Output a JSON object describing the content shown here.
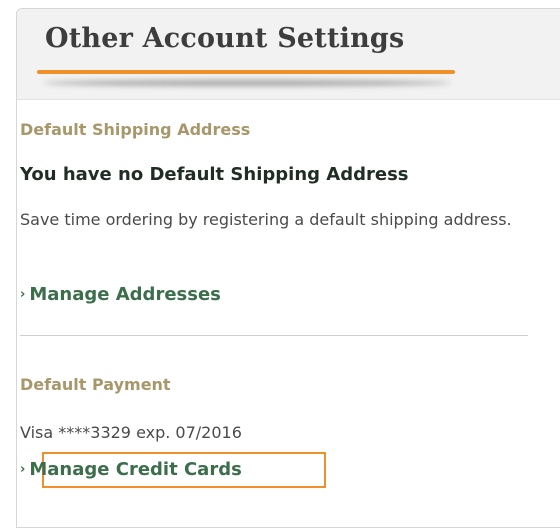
{
  "header": {
    "title": "Other Account Settings"
  },
  "shipping": {
    "heading": "Default Shipping Address",
    "status": "You have no Default Shipping Address",
    "description": "Save time ordering by registering a default shipping address.",
    "link_label": "Manage Addresses",
    "link_icon": "chevron-right-icon"
  },
  "payment": {
    "heading": "Default Payment",
    "card": "Visa ****3329 exp. 07/2016",
    "link_label": "Manage Credit Cards",
    "link_icon": "chevron-right-icon"
  },
  "colors": {
    "accent": "#f0902a",
    "section_heading": "#a8976a",
    "link": "#3c6e4c",
    "header_bg": "#f2f2f2"
  }
}
